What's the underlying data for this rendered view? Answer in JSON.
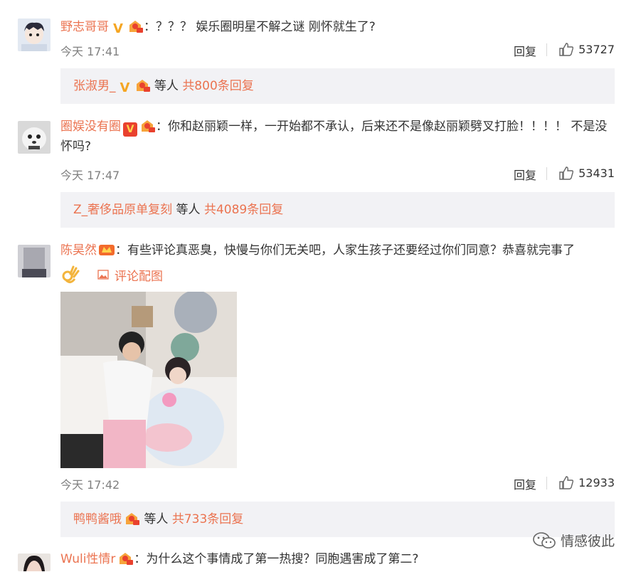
{
  "comments": [
    {
      "username": "野志哥哥",
      "colon_text": "：？？？ 娱乐圈明星不解之谜 刚怀就生了?",
      "time": "今天 17:41",
      "reply_label": "回复",
      "likes": "53727",
      "sub_user": "张淑男_",
      "sub_mid": " 等人 ",
      "sub_count": "共800条回复"
    },
    {
      "username": "圈娱没有圈",
      "colon_text": "：你和赵丽颖一样，一开始都不承认，后来还不是像赵丽颖劈叉打脸！！！！ 不是没怀吗?",
      "time": "今天 17:47",
      "reply_label": "回复",
      "likes": "53431",
      "sub_user": "Z_奢侈品原单复刻",
      "sub_mid": " 等人 ",
      "sub_count": "共4089条回复"
    },
    {
      "username": "陈昊然",
      "colon_text": "：有些评论真恶臭，快慢与你们无关吧，人家生孩子还要经过你们同意？恭喜就完事了",
      "attach_label": "评论配图",
      "time": "今天 17:42",
      "reply_label": "回复",
      "likes": "12933",
      "sub_user": "鸭鸭酱哦",
      "sub_mid": " 等人 ",
      "sub_count": "共733条回复"
    },
    {
      "username": "Wuli性情r",
      "colon_text": "：为什么这个事情成了第一热搜？同胞遇害成了第二?"
    }
  ],
  "watermark": "情感彼此",
  "colors": {
    "accent": "#eb7350",
    "subbox_bg": "#f2f2f5",
    "meta": "#808080"
  }
}
